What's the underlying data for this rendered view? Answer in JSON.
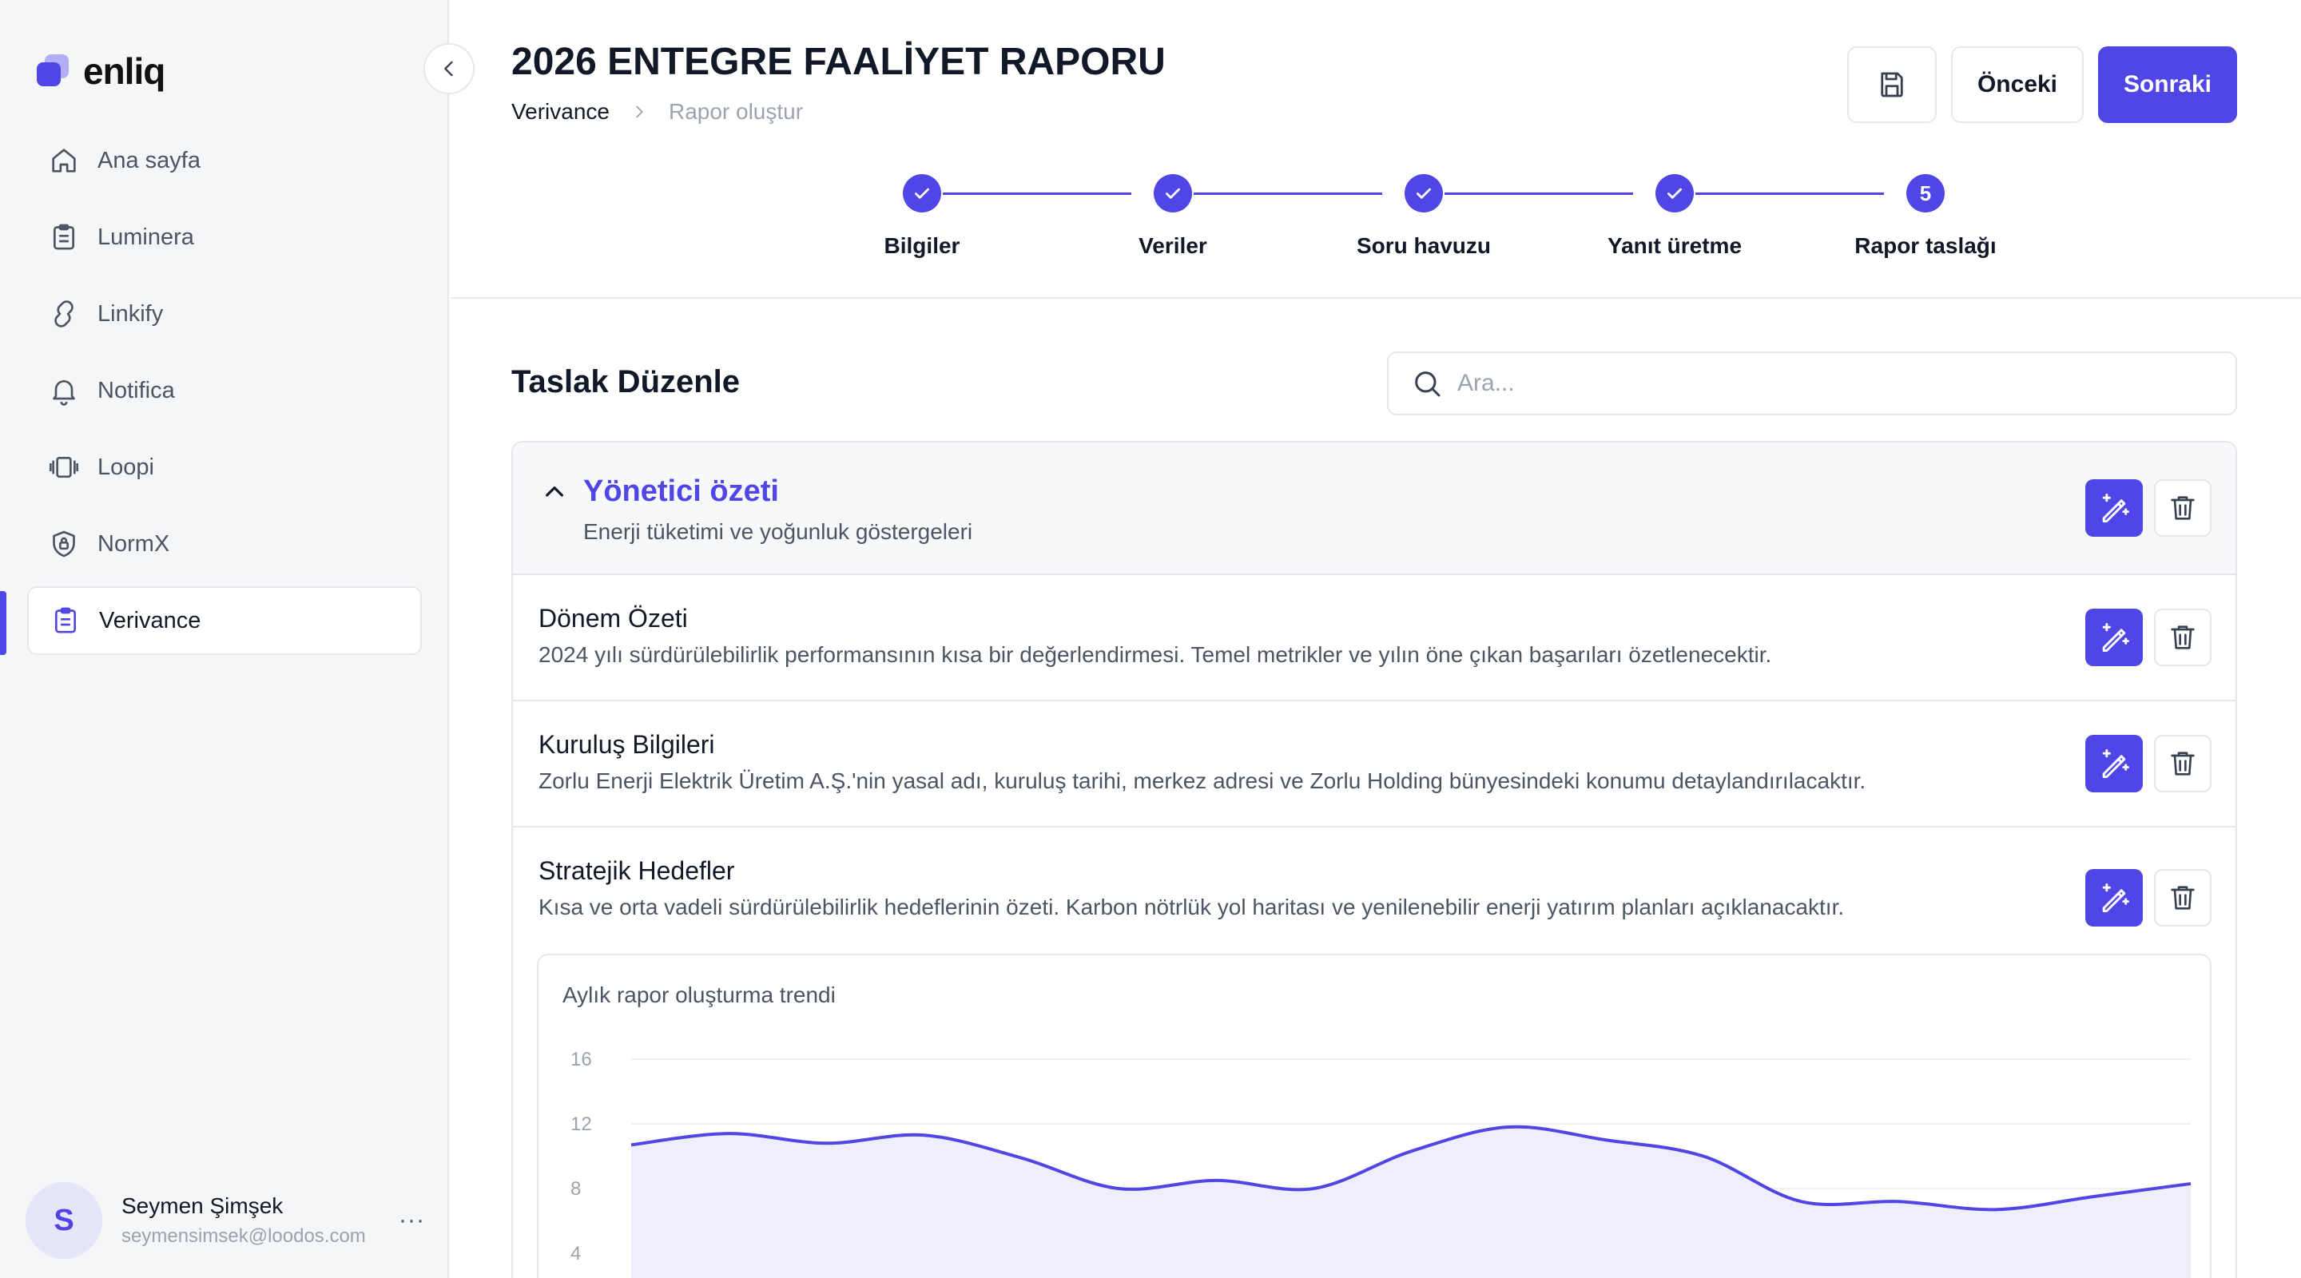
{
  "app": {
    "logo_text": "enliq"
  },
  "sidebar": {
    "items": [
      {
        "label": "Ana sayfa",
        "icon": "home-icon"
      },
      {
        "label": "Luminera",
        "icon": "clipboard-icon"
      },
      {
        "label": "Linkify",
        "icon": "link-icon"
      },
      {
        "label": "Notifica",
        "icon": "bell-icon"
      },
      {
        "label": "Loopi",
        "icon": "loop-icon"
      },
      {
        "label": "NormX",
        "icon": "shield-lock-icon"
      },
      {
        "label": "Verivance",
        "icon": "clipboard-list-icon",
        "active": true
      }
    ],
    "user": {
      "initial": "S",
      "name": "Seymen Şimşek",
      "email": "seymensimsek@loodos.com",
      "more": "···"
    }
  },
  "header": {
    "title": "2026 ENTEGRE FAALİYET RAPORU",
    "breadcrumb": [
      "Verivance",
      "Rapor oluştur"
    ],
    "prev_label": "Önceki",
    "next_label": "Sonraki"
  },
  "stepper": {
    "steps": [
      {
        "label": "Bilgiler",
        "state": "done"
      },
      {
        "label": "Veriler",
        "state": "done"
      },
      {
        "label": "Soru havuzu",
        "state": "done"
      },
      {
        "label": "Yanıt üretme",
        "state": "done"
      },
      {
        "label": "Rapor taslağı",
        "state": "current",
        "number": "5"
      }
    ]
  },
  "main": {
    "section_title": "Taslak Düzenle",
    "search_placeholder": "Ara...",
    "group": {
      "title": "Yönetici özeti",
      "subtitle": "Enerji tüketimi ve yoğunluk göstergeleri"
    },
    "rows": [
      {
        "title": "Dönem Özeti",
        "desc": "2024 yılı sürdürülebilirlik performansının kısa bir değerlendirmesi. Temel metrikler ve yılın öne çıkan başarıları özetlenecektir."
      },
      {
        "title": "Kuruluş Bilgileri",
        "desc": "Zorlu Enerji Elektrik Üretim A.Ş.'nin yasal adı, kuruluş tarihi, merkez adresi ve Zorlu Holding bünyesindeki konumu detaylandırılacaktır."
      },
      {
        "title": "Stratejik Hedefler",
        "desc": "Kısa ve orta vadeli sürdürülebilirlik hedeflerinin özeti. Karbon nötrlük yol haritası ve yenilenebilir enerji yatırım planları açıklanacaktır."
      }
    ]
  },
  "colors": {
    "accent": "#4f46e5",
    "chart_fill": "#efeefc",
    "border": "#e5e7eb"
  },
  "chart_data": {
    "type": "area",
    "title": "Aylık rapor oluşturma trendi",
    "y_ticks": [
      "16",
      "12",
      "8",
      "4"
    ],
    "ylim": [
      0,
      16
    ],
    "values": [
      10.7,
      11.4,
      10.8,
      11.3,
      9.9,
      8.0,
      8.5,
      8.0,
      10.3,
      11.8,
      11.0,
      10.0,
      7.2,
      7.2,
      6.7,
      7.5,
      8.3
    ],
    "grid": true
  }
}
